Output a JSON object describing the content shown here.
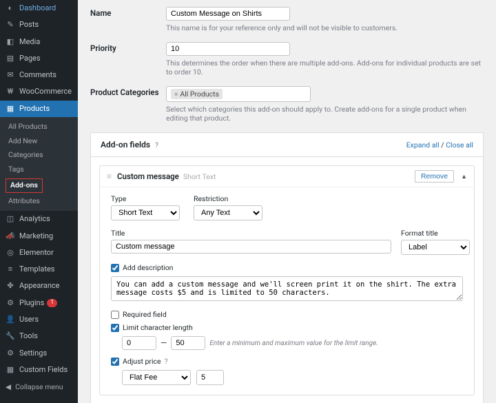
{
  "sidebar": {
    "collapse_label": "Collapse menu",
    "menu": [
      {
        "icon": "◐",
        "label": "Dashboard"
      },
      {
        "icon": "✎",
        "label": "Posts"
      },
      {
        "icon": "◧",
        "label": "Media"
      },
      {
        "icon": "▤",
        "label": "Pages"
      },
      {
        "icon": "✉",
        "label": "Comments"
      },
      {
        "icon": "₩",
        "label": "WooCommerce"
      },
      {
        "icon": "▦",
        "label": "Products",
        "active": true
      },
      {
        "icon": "◫",
        "label": "Analytics"
      },
      {
        "icon": "📣",
        "label": "Marketing"
      },
      {
        "icon": "◎",
        "label": "Elementor"
      },
      {
        "icon": "≡",
        "label": "Templates"
      },
      {
        "icon": "✤",
        "label": "Appearance"
      },
      {
        "icon": "⚙",
        "label": "Plugins",
        "badge": "1"
      },
      {
        "icon": "👤",
        "label": "Users"
      },
      {
        "icon": "🔧",
        "label": "Tools"
      },
      {
        "icon": "⚙",
        "label": "Settings"
      },
      {
        "icon": "▦",
        "label": "Custom Fields"
      }
    ],
    "products_submenu": [
      "All Products",
      "Add New",
      "Categories",
      "Tags",
      "Add-ons",
      "Attributes"
    ],
    "products_current": "Add-ons"
  },
  "form": {
    "name": {
      "label": "Name",
      "value": "Custom Message on Shirts",
      "desc": "This name is for your reference only and will not be visible to customers."
    },
    "priority": {
      "label": "Priority",
      "value": "10",
      "desc": "This determines the order when there are multiple add-ons. Add-ons for individual products are set to order 10."
    },
    "categories": {
      "label": "Product Categories",
      "tag": "All Products",
      "desc": "Select which categories this add-on should apply to. Create add-ons for a single product when editing that product."
    }
  },
  "panel": {
    "title": "Add-on fields",
    "help": "?",
    "expand": "Expand all",
    "sep": " / ",
    "close": "Close all"
  },
  "addon": {
    "name": "Custom message",
    "type_hint": "Short Text",
    "remove": "Remove",
    "type_label": "Type",
    "type_value": "Short Text",
    "restriction_label": "Restriction",
    "restriction_value": "Any Text",
    "title_label": "Title",
    "title_value": "Custom message",
    "format_label": "Format title",
    "format_value": "Label",
    "add_desc": "Add description",
    "desc_text": "You can add a custom message and we'll screen print it on the shirt. The extra message costs $5 and is limited to 50 characters.",
    "required": "Required field",
    "limit": "Limit character length",
    "limit_min": "0",
    "limit_max": "50",
    "limit_hint": "Enter a minimum and maximum value for the limit range.",
    "adjust": "Adjust price",
    "fee_type": "Flat Fee",
    "fee_value": "5"
  }
}
